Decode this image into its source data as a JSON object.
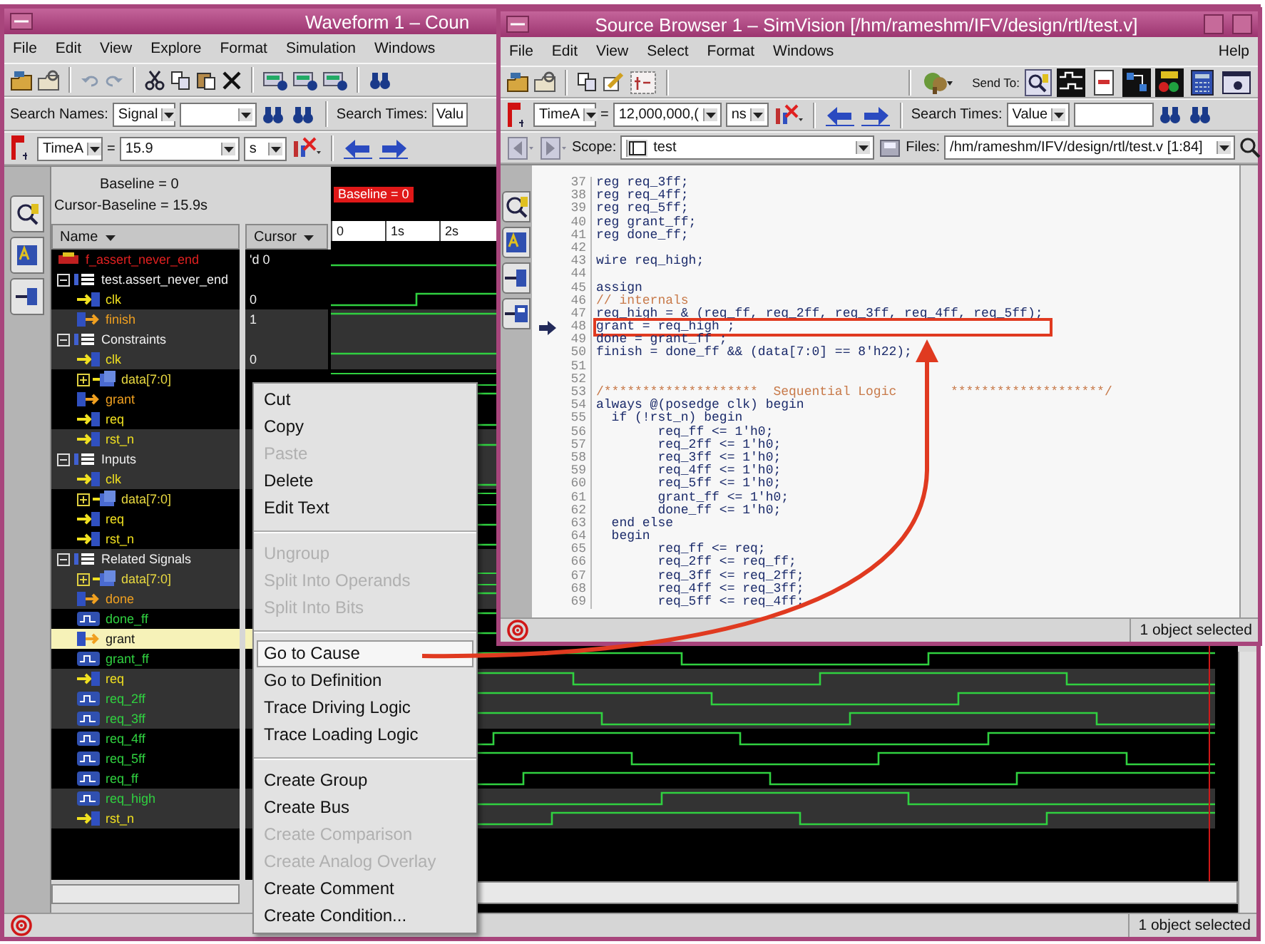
{
  "waveform_window": {
    "title": "Waveform 1 – Coun",
    "menu": [
      "File",
      "Edit",
      "View",
      "Explore",
      "Format",
      "Simulation",
      "Windows"
    ],
    "search_names": {
      "label": "Search Names:",
      "type": "Signal"
    },
    "search_times": {
      "label": "Search Times:",
      "type": "Valu"
    },
    "cursor_bar": {
      "cursor": "TimeA",
      "operator": "=",
      "value": "15.9",
      "unit": "s"
    },
    "baseline": "Baseline = 0",
    "cursor_baseline": "Cursor-Baseline = 15.9s",
    "columns": [
      "Name",
      "Cursor"
    ],
    "timeline": {
      "marker": "Baseline = 0",
      "ticks": [
        "0",
        "1s",
        "2s"
      ]
    },
    "signals": [
      {
        "name": "f_assert_never_end",
        "kind": "assertion",
        "value": "'d 0",
        "selected": false
      },
      {
        "name": "test.assert_never_end",
        "kind": "group",
        "expanded": true,
        "selected": false,
        "children": [
          {
            "name": "clk",
            "kind": "input",
            "value": "0",
            "selected": false
          },
          {
            "name": "finish",
            "kind": "output",
            "value": "1",
            "selected": false
          }
        ]
      },
      {
        "name": "Constraints",
        "kind": "group",
        "expanded": true,
        "selected": false,
        "children": [
          {
            "name": "clk",
            "kind": "input",
            "value": "0",
            "selected": false
          },
          {
            "name": "data[7:0]",
            "kind": "bus",
            "expanded": false,
            "selected": false
          },
          {
            "name": "grant",
            "kind": "output",
            "selected": false
          },
          {
            "name": "req",
            "kind": "input",
            "selected": false
          },
          {
            "name": "rst_n",
            "kind": "input",
            "selected": false
          }
        ]
      },
      {
        "name": "Inputs",
        "kind": "group",
        "expanded": true,
        "selected": false,
        "children": [
          {
            "name": "clk",
            "kind": "input",
            "selected": false
          },
          {
            "name": "data[7:0]",
            "kind": "bus",
            "expanded": false,
            "selected": false
          },
          {
            "name": "req",
            "kind": "input",
            "selected": false
          },
          {
            "name": "rst_n",
            "kind": "input",
            "selected": false
          }
        ]
      },
      {
        "name": "Related Signals",
        "kind": "group",
        "expanded": true,
        "selected": false,
        "children": [
          {
            "name": "data[7:0]",
            "kind": "bus",
            "expanded": false,
            "selected": false
          },
          {
            "name": "done",
            "kind": "output",
            "selected": false
          },
          {
            "name": "done_ff",
            "kind": "reg",
            "selected": false
          },
          {
            "name": "grant",
            "kind": "output",
            "selected": true
          },
          {
            "name": "grant_ff",
            "kind": "reg",
            "selected": false
          },
          {
            "name": "req",
            "kind": "input",
            "selected": false
          },
          {
            "name": "req_2ff",
            "kind": "reg",
            "selected": false
          },
          {
            "name": "req_3ff",
            "kind": "reg",
            "selected": false
          },
          {
            "name": "req_4ff",
            "kind": "reg",
            "selected": false
          },
          {
            "name": "req_5ff",
            "kind": "reg",
            "selected": false
          },
          {
            "name": "req_ff",
            "kind": "reg",
            "selected": false
          },
          {
            "name": "req_high",
            "kind": "reg",
            "selected": false
          },
          {
            "name": "rst_n",
            "kind": "input",
            "selected": false
          }
        ]
      }
    ],
    "status": "1 object selected"
  },
  "source_window": {
    "title": "Source Browser 1 – SimVision [/hm/rameshm/IFV/design/rtl/test.v]",
    "menu": [
      "File",
      "Edit",
      "View",
      "Select",
      "Format",
      "Windows"
    ],
    "help": "Help",
    "send_to": "Send To:",
    "cursor_bar": {
      "cursor": "TimeA",
      "operator": "=",
      "value": "12,000,000,(",
      "unit": "ns"
    },
    "search_times": {
      "label": "Search Times:",
      "type": "Value"
    },
    "scope": {
      "label": "Scope:",
      "value": "test"
    },
    "files": {
      "label": "Files:",
      "value": "/hm/rameshm/IFV/design/rtl/test.v [1:84]"
    },
    "code": [
      {
        "number": "37",
        "text": "reg req_3ff;",
        "kind": "code",
        "selected": false
      },
      {
        "number": "38",
        "text": "reg req_4ff;",
        "kind": "code",
        "selected": false
      },
      {
        "number": "39",
        "text": "reg req_5ff;",
        "kind": "code",
        "selected": false
      },
      {
        "number": "40",
        "text": "reg grant_ff;",
        "kind": "code",
        "selected": false
      },
      {
        "number": "41",
        "text": "reg done_ff;",
        "kind": "code",
        "selected": false
      },
      {
        "number": "42",
        "selected": false
      },
      {
        "number": "43",
        "text": "wire req_high;",
        "kind": "code",
        "selected": false
      },
      {
        "number": "44",
        "selected": false
      },
      {
        "number": "45",
        "text": "assign",
        "kind": "code",
        "selected": false
      },
      {
        "number": "46",
        "text": "// internals",
        "kind": "comment",
        "selected": false
      },
      {
        "number": "47",
        "text": "req_high = & (req_ff, req_2ff, req_3ff, req_4ff, req_5ff);",
        "kind": "code",
        "selected": false
      },
      {
        "number": "48",
        "text": "grant = req_high ;",
        "kind": "code",
        "selected": true
      },
      {
        "number": "49",
        "text": "done = grant_ff ;",
        "kind": "code",
        "selected": false
      },
      {
        "number": "50",
        "text": "finish = done_ff && (data[7:0] == 8'h22);",
        "kind": "code",
        "selected": false
      },
      {
        "number": "51",
        "selected": false
      },
      {
        "number": "52",
        "selected": false
      },
      {
        "number": "53",
        "text": "/********************  Sequential Logic       ********************/",
        "kind": "comment",
        "selected": false
      },
      {
        "number": "54",
        "text": "always @(posedge clk) begin",
        "kind": "code",
        "selected": false
      },
      {
        "number": "55",
        "text": "  if (!rst_n) begin",
        "kind": "code",
        "selected": false
      },
      {
        "number": "56",
        "text": "        req_ff <= 1'h0;",
        "kind": "code",
        "selected": false
      },
      {
        "number": "57",
        "text": "        req_2ff <= 1'h0;",
        "kind": "code",
        "selected": false
      },
      {
        "number": "58",
        "text": "        req_3ff <= 1'h0;",
        "kind": "code",
        "selected": false
      },
      {
        "number": "59",
        "text": "        req_4ff <= 1'h0;",
        "kind": "code",
        "selected": false
      },
      {
        "number": "60",
        "text": "        req_5ff <= 1'h0;",
        "kind": "code",
        "selected": false
      },
      {
        "number": "61",
        "text": "        grant_ff <= 1'h0;",
        "kind": "code",
        "selected": false
      },
      {
        "number": "62",
        "text": "        done_ff <= 1'h0;",
        "kind": "code",
        "selected": false
      },
      {
        "number": "63",
        "text": "  end else",
        "kind": "code",
        "selected": false
      },
      {
        "number": "64",
        "text": "  begin",
        "kind": "code",
        "selected": false
      },
      {
        "number": "65",
        "text": "        req_ff <= req;",
        "kind": "code",
        "selected": false
      },
      {
        "number": "66",
        "text": "        req_2ff <= req_ff;",
        "kind": "code",
        "selected": false
      },
      {
        "number": "67",
        "text": "        req_3ff <= req_2ff;",
        "kind": "code",
        "selected": false
      },
      {
        "number": "68",
        "text": "        req_4ff <= req_3ff;",
        "kind": "code",
        "selected": false
      },
      {
        "number": "69",
        "text": "        req_5ff <= req_4ff;",
        "kind": "code",
        "selected": false
      }
    ],
    "status": "1 object selected"
  },
  "context_menu": [
    {
      "kind": "item",
      "label": "Cut",
      "disabled": false,
      "selected": false
    },
    {
      "kind": "item",
      "label": "Copy",
      "disabled": false,
      "selected": false
    },
    {
      "kind": "item",
      "label": "Paste",
      "disabled": true,
      "selected": false
    },
    {
      "kind": "item",
      "label": "Delete",
      "disabled": false,
      "selected": false
    },
    {
      "kind": "item",
      "label": "Edit Text",
      "disabled": false,
      "selected": false
    },
    {
      "kind": "separator"
    },
    {
      "kind": "item",
      "label": "Ungroup",
      "disabled": true,
      "selected": false
    },
    {
      "kind": "item",
      "label": "Split Into Operands",
      "disabled": true,
      "selected": false
    },
    {
      "kind": "item",
      "label": "Split Into Bits",
      "disabled": true,
      "selected": false
    },
    {
      "kind": "separator"
    },
    {
      "kind": "item",
      "label": "Go to Cause",
      "disabled": false,
      "selected": true
    },
    {
      "kind": "item",
      "label": "Go to Definition",
      "disabled": false,
      "selected": false
    },
    {
      "kind": "item",
      "label": "Trace Driving Logic",
      "disabled": false,
      "selected": false
    },
    {
      "kind": "item",
      "label": "Trace Loading Logic",
      "disabled": false,
      "selected": false
    },
    {
      "kind": "separator"
    },
    {
      "kind": "item",
      "label": "Create Group",
      "disabled": false,
      "selected": false
    },
    {
      "kind": "item",
      "label": "Create Bus",
      "disabled": false,
      "selected": false
    },
    {
      "kind": "item",
      "label": "Create Comparison",
      "disabled": true,
      "selected": false
    },
    {
      "kind": "item",
      "label": "Create Analog Overlay",
      "disabled": true,
      "selected": false
    },
    {
      "kind": "item",
      "label": "Create Comment",
      "disabled": false,
      "selected": false
    },
    {
      "kind": "item",
      "label": "Create Condition...",
      "disabled": false,
      "selected": false
    }
  ]
}
